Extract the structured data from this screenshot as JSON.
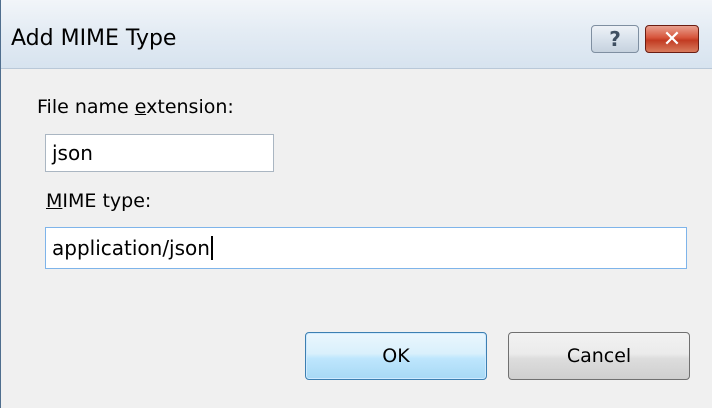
{
  "dialog": {
    "title": "Add MIME Type",
    "help_glyph": "?",
    "close_glyph": "✕"
  },
  "extension": {
    "label_pre": "File name ",
    "label_accel": "e",
    "label_post": "xtension:",
    "value": "json"
  },
  "mime": {
    "label_accel": "M",
    "label_post": "IME type:",
    "value": "application/json"
  },
  "buttons": {
    "ok": "OK",
    "cancel": "Cancel"
  },
  "colors": {
    "title_bar": "#dbe6f2",
    "close_button": "#c8432b",
    "ok_button": "#bee6fd",
    "dialog_bg": "#f0f0f0"
  }
}
